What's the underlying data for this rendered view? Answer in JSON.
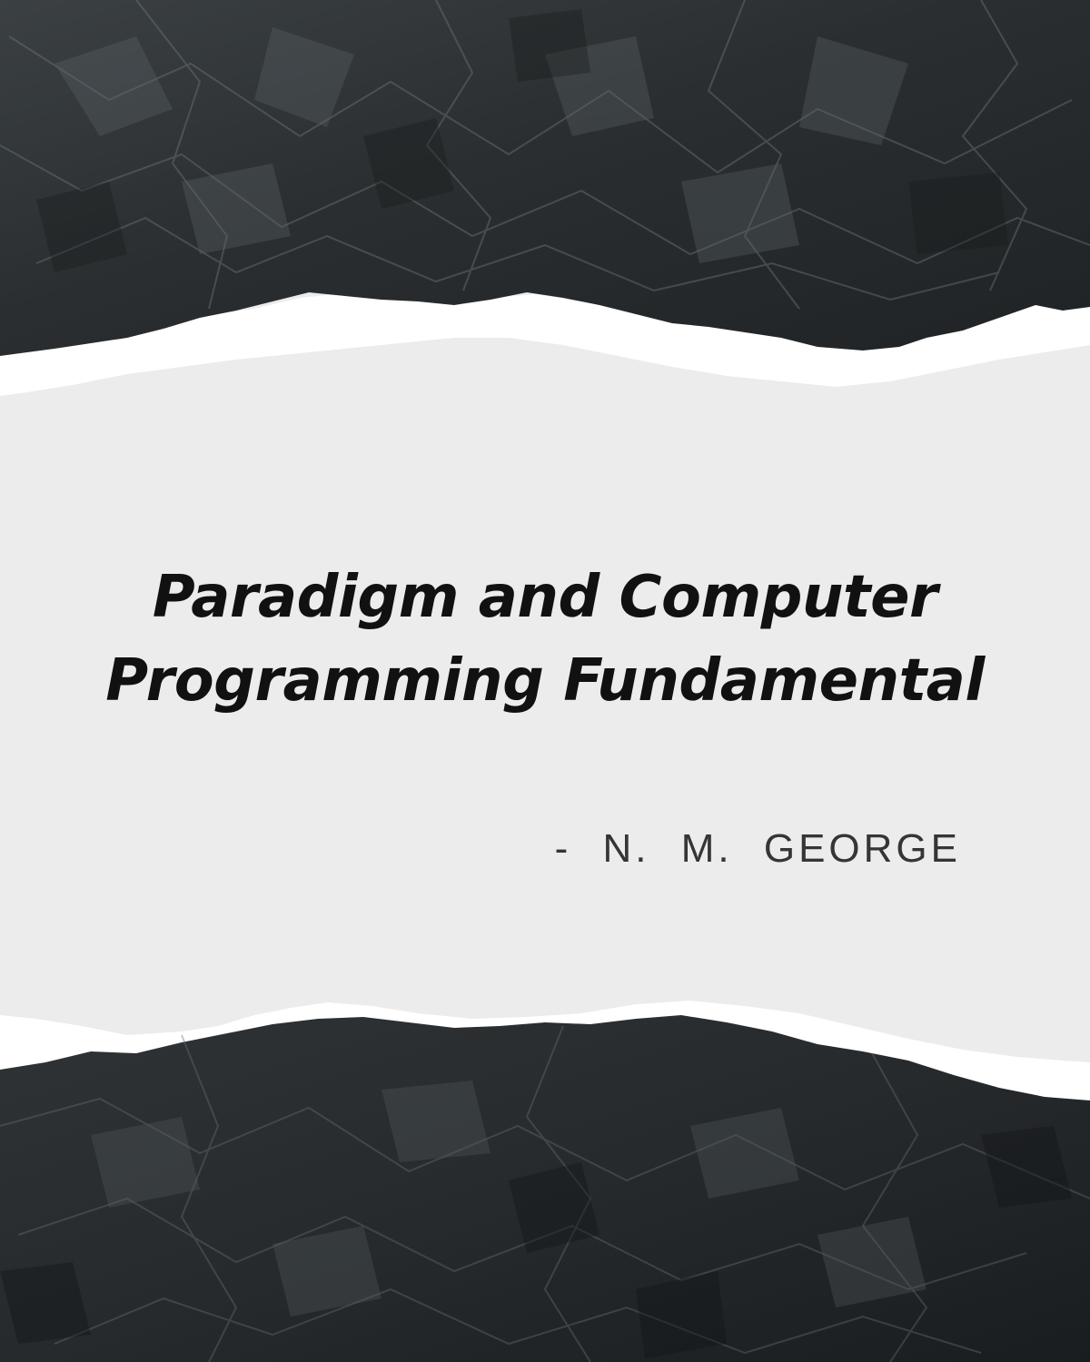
{
  "cover": {
    "title_lines": [
      "Paradigm and Computer",
      "Programming Fundamental"
    ],
    "author": "- N. M. GEORGE",
    "colors": {
      "background": "#ececec",
      "paper_dark": "#2c3032",
      "paper_light": "#4a4f52",
      "torn_edge": "#ffffff",
      "title_text": "#111111",
      "author_text": "#353535"
    },
    "decorations": [
      "crumpled-black-paper-top",
      "torn-white-edge-top",
      "torn-white-edge-bottom",
      "crumpled-black-paper-bottom"
    ]
  }
}
